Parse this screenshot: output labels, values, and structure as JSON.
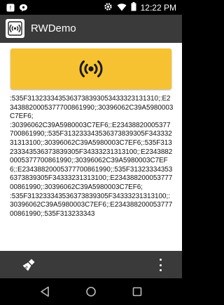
{
  "status_bar": {
    "time": "12:22 PM",
    "icons": [
      "notification-icon",
      "chat-bubble-icon",
      "settings-icon",
      "wifi-icon",
      "battery-icon"
    ]
  },
  "app_bar": {
    "title": "RWDemo",
    "logo_icon": "nfc-reader-icon"
  },
  "main": {
    "read_button_icon": "rfid-scan-icon",
    "accent_color": "#f7c232",
    "log_text": ":535F3132333435363738393053433323131310;:E23438820005377700861990;:30396062C39A5980003C7EF6;\n:30396062C39A5980003C7EF6;:E234388200053777008619​90;:535F313233343536373839305F34333231313100;:30396062C39A5980003C7EF6;:535F313233343536373839305F34333231313100;:E23438820005377700861990;:30396062C39A5980003C7EF6;:E23438820005377700861990;:535F31323334353637383930​5F34333231313100;:E23438820005377700861990;:30396062C39A5980003C7EF6;\n:535F313233343536373839305F34333231313100;:30396062C39A5980003C7EF6;:E23438820005377700861990;:535F313233343"
  },
  "bottom_toolbar": {
    "clean_icon": "broom-icon",
    "more_icon": "more-vert-icon"
  },
  "nav_bar": {
    "back_icon": "back-icon",
    "home_icon": "home-icon",
    "recents_icon": "recents-icon"
  }
}
